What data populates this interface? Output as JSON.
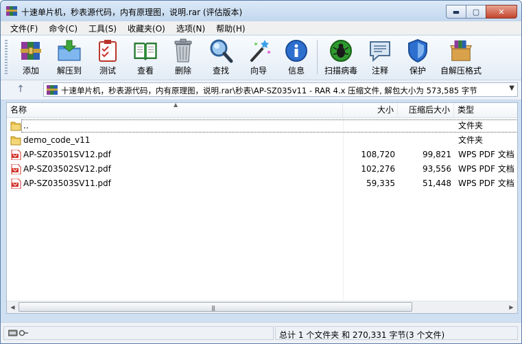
{
  "window": {
    "title": "十速单片机，秒表源代码，内有原理图，说明.rar (评估版本)",
    "caption_buttons": {
      "minimize": "▬",
      "maximize": "▢",
      "close": "✕"
    }
  },
  "menu": [
    "文件(F)",
    "命令(C)",
    "工具(S)",
    "收藏夹(O)",
    "选项(N)",
    "帮助(H)"
  ],
  "toolbar": [
    {
      "label": "添加",
      "icon": "add-archive-icon"
    },
    {
      "label": "解压到",
      "icon": "extract-to-icon"
    },
    {
      "label": "测试",
      "icon": "test-icon"
    },
    {
      "label": "查看",
      "icon": "view-book-icon"
    },
    {
      "label": "删除",
      "icon": "trash-icon"
    },
    {
      "label": "查找",
      "icon": "find-magnifier-icon"
    },
    {
      "label": "向导",
      "icon": "wizard-wand-icon"
    },
    {
      "label": "信息",
      "icon": "info-icon"
    },
    {
      "label": "扫描病毒",
      "icon": "virus-scan-icon"
    },
    {
      "label": "注释",
      "icon": "comment-icon"
    },
    {
      "label": "保护",
      "icon": "shield-icon"
    },
    {
      "label": "自解压格式",
      "icon": "sfx-box-icon"
    }
  ],
  "address": {
    "up": "↑",
    "path": "十速单片机，秒表源代码，内有原理图，说明.rar\\秒表\\AP-SZ035v11 - RAR 4.x 压缩文件, 解包大小为 573,585 字节",
    "dropdown": "▼"
  },
  "columns": {
    "name": "名称",
    "size": "大小",
    "packed": "压缩后大小",
    "type": "类型"
  },
  "files": [
    {
      "name": "..",
      "size": "",
      "packed": "",
      "type": "文件夹",
      "icon": "folder-icon"
    },
    {
      "name": "demo_code_v11",
      "size": "",
      "packed": "",
      "type": "文件夹",
      "icon": "folder-icon"
    },
    {
      "name": "AP-SZ03501SV12.pdf",
      "size": "108,720",
      "packed": "99,821",
      "type": "WPS PDF 文档",
      "icon": "pdf-icon"
    },
    {
      "name": "AP-SZ03502SV12.pdf",
      "size": "102,276",
      "packed": "93,556",
      "type": "WPS PDF 文档",
      "icon": "pdf-icon"
    },
    {
      "name": "AP-SZ03503SV11.pdf",
      "size": "59,335",
      "packed": "51,448",
      "type": "WPS PDF 文档",
      "icon": "pdf-icon"
    }
  ],
  "scrollbar": {
    "left": "◀",
    "right": "▶",
    "grip": "|||"
  },
  "status": {
    "summary": "总计 1 个文件夹 和 270,331 字节(3 个文件)"
  },
  "colors": {
    "title_bg": "#c9dcf0",
    "close_btn": "#c3452d",
    "pdf_red": "#d2352c",
    "folder_yellow": "#e8c04a"
  }
}
